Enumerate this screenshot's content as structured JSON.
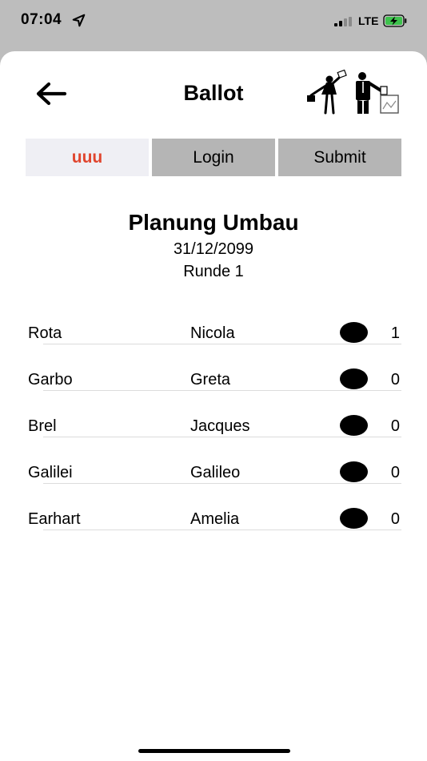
{
  "status_bar": {
    "time": "07:04",
    "network": "LTE",
    "signal_bars_active": 2,
    "battery_charging": true
  },
  "header": {
    "title": "Ballot",
    "back_icon": "arrow-left-icon",
    "logo_icon": "voters-casting-ballot-logo"
  },
  "tabs": [
    {
      "label": "uuu",
      "active": true,
      "color": "#e0452e"
    },
    {
      "label": "Login",
      "active": false
    },
    {
      "label": "Submit",
      "active": false
    }
  ],
  "ballot": {
    "title": "Planung Umbau",
    "date": "31/12/2099",
    "round": "Runde 1"
  },
  "candidates": [
    {
      "last": "Rota",
      "first": "Nicola",
      "votes": "1"
    },
    {
      "last": "Garbo",
      "first": "Greta",
      "votes": "0"
    },
    {
      "last": "Brel",
      "first": "Jacques",
      "votes": "0"
    },
    {
      "last": "Galilei",
      "first": "Galileo",
      "votes": "0"
    },
    {
      "last": "Earhart",
      "first": "Amelia",
      "votes": "0"
    }
  ],
  "colors": {
    "accent": "#e0452e",
    "tab_inactive": "#b5b5b5",
    "tab_active": "#efeff4",
    "status_background": "#bdbdbd"
  }
}
